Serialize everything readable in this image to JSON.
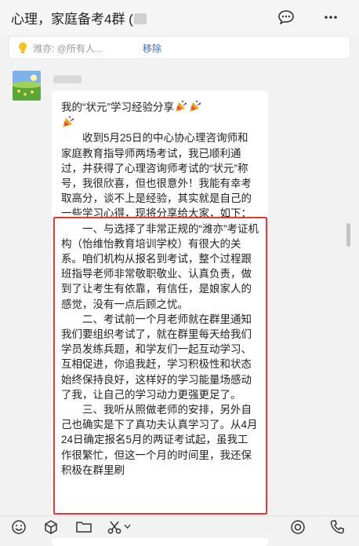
{
  "header": {
    "title": "心理，家庭备考4群 ("
  },
  "notice": {
    "text": "潍亦: @所有人...",
    "remove_label": "移除"
  },
  "message": {
    "first_line": "我的“状元”学习经验分享",
    "paragraphs": [
      "收到5月25日的中心协心理咨询师和家庭教育指导师两场考试，我已顺利通过，并获得了心理咨询师考试的“状元”称号，我很欣喜，但也很意外！我能有幸考取高分，谈不上是经验，其实就是自己的一些学习心得，现将分享给大家，如下：",
      "一、与选择了非常正规的“潍亦”考证机构（怡维怡教育培训学校）有很大的关系。咱们机构从报名到考试，整个过程跟班指导老师非常敬职敬业、认真负责，做到了让考生有依靠，有信任，是娘家人的感觉，没有一点后顾之忧。",
      "二、考试前一个月老师就在群里通知我们要组织考试了，就在群里每天给我们学员发练兵题，和学友们一起互动学习、互相促进，你追我赶，学习积极性和状态始终保持良好，这样好的学习能量场感动了我，让自己的学习动力更强更足了。",
      "三、我听从照做老师的安排，另外自己也确实是下了真功夫认真学习了。从4月24日确定报名5月的两证考试起，虽我工作很繁忙，但这一个月的时间里，我还保积极在群里刷"
    ]
  },
  "icons": {
    "chat": "chat-bubble-icon",
    "more": "more-icon",
    "bulb": "lightbulb-icon",
    "party": "party-popper-icon",
    "emoji": "emoji-icon",
    "package": "package-icon",
    "folder": "folder-icon",
    "scissors": "scissors-icon",
    "record": "record-icon",
    "phone": "phone-icon"
  },
  "colors": {
    "highlight_box": "#e53935",
    "link": "#3b6fb6",
    "notice_text": "#999999"
  }
}
